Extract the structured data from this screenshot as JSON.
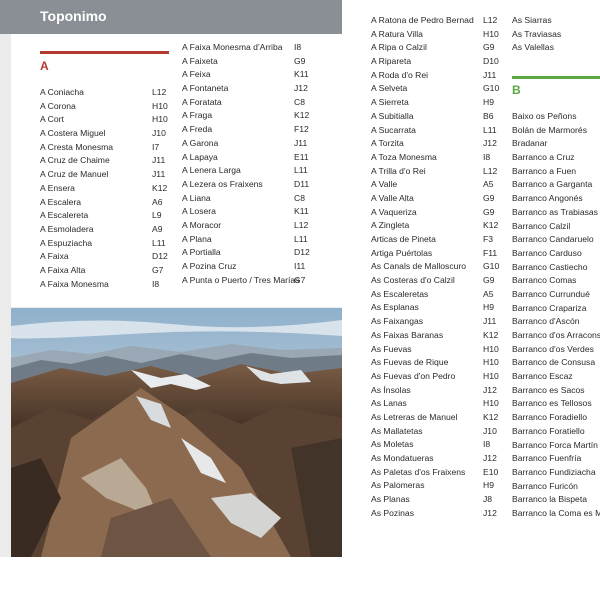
{
  "header": {
    "title": "Toponimo"
  },
  "section_a": {
    "letter": "A",
    "color": "#b23a2e",
    "entries": [
      {
        "name": "A Coniacha",
        "code": "L12"
      },
      {
        "name": "A Corona",
        "code": "H10"
      },
      {
        "name": "A Cort",
        "code": "H10"
      },
      {
        "name": "A Costera Miguel",
        "code": "J10"
      },
      {
        "name": "A Cresta Monesma",
        "code": "I7"
      },
      {
        "name": "A Cruz de Chaime",
        "code": "J11"
      },
      {
        "name": "A Cruz de Manuel",
        "code": "J11"
      },
      {
        "name": "A Ensera",
        "code": "K12"
      },
      {
        "name": "A Escalera",
        "code": "A6"
      },
      {
        "name": "A Escalereta",
        "code": "L9"
      },
      {
        "name": "A Esmoladera",
        "code": "A9"
      },
      {
        "name": "A Espuziacha",
        "code": "L11"
      },
      {
        "name": "A Faixa",
        "code": "D12"
      },
      {
        "name": "A Faixa Alta",
        "code": "G7"
      },
      {
        "name": "A Faixa Monesma",
        "code": "I8"
      }
    ]
  },
  "column_2": {
    "entries": [
      {
        "name": "A Faixa Monesma d'Arriba",
        "code": "I8"
      },
      {
        "name": "A Faixeta",
        "code": "G9"
      },
      {
        "name": "A Feixa",
        "code": "K11"
      },
      {
        "name": "A Fontaneta",
        "code": "J12"
      },
      {
        "name": "A Foratata",
        "code": "C8"
      },
      {
        "name": "A Fraga",
        "code": "K12"
      },
      {
        "name": "A Freda",
        "code": "F12"
      },
      {
        "name": "A Garona",
        "code": "J11"
      },
      {
        "name": "A Lapaya",
        "code": "E11"
      },
      {
        "name": "A Lenera Larga",
        "code": "L11"
      },
      {
        "name": "A Lezera os  Fraixens",
        "code": "D11"
      },
      {
        "name": "A Liana",
        "code": "C8"
      },
      {
        "name": "A Losera",
        "code": "K11"
      },
      {
        "name": "A Moracor",
        "code": "L12"
      },
      {
        "name": "A Plana",
        "code": "L11"
      },
      {
        "name": "A Portialla",
        "code": "D12"
      },
      {
        "name": "A Pozina Cruz",
        "code": "I11"
      },
      {
        "name": "A Punta o Puerto / Tres Marías",
        "code": "G7"
      }
    ]
  },
  "column_3": {
    "entries": [
      {
        "name": "A Ratona de Pedro Bernad",
        "code": "L12"
      },
      {
        "name": "A Ratura Villa",
        "code": "H10"
      },
      {
        "name": "A Ripa o Calzil",
        "code": "G9"
      },
      {
        "name": "A Ripareta",
        "code": "D10"
      },
      {
        "name": "A Roda d'o Rei",
        "code": "J11"
      },
      {
        "name": "A Selveta",
        "code": "G10"
      },
      {
        "name": "A Sierreta",
        "code": "H9"
      },
      {
        "name": "A Subitialla",
        "code": "B6"
      },
      {
        "name": "A Sucarrata",
        "code": "L11"
      },
      {
        "name": "A Torzita",
        "code": "J12"
      },
      {
        "name": "A Toza Monesma",
        "code": "I8"
      },
      {
        "name": "A Trilla d'o Rei",
        "code": "L12"
      },
      {
        "name": "A Valle",
        "code": "A5"
      },
      {
        "name": "A Valle Alta",
        "code": "G9"
      },
      {
        "name": "A Vaqueriza",
        "code": "G9"
      },
      {
        "name": "A Zingleta",
        "code": "K12"
      },
      {
        "name": "Articas de Pineta",
        "code": "F3"
      },
      {
        "name": "Artiga Puértolas",
        "code": "F11"
      },
      {
        "name": "As Canals de Malloscuro",
        "code": "G10"
      },
      {
        "name": "As Costeras d'o Calzil",
        "code": "G9"
      },
      {
        "name": "As Escaleretas",
        "code": "A5"
      },
      {
        "name": "As Esplanas",
        "code": "H9"
      },
      {
        "name": "As Faixangas",
        "code": "J11"
      },
      {
        "name": "As Faixas Baranas",
        "code": "K12"
      },
      {
        "name": "As Fuevas",
        "code": "H10"
      },
      {
        "name": "As Fuevas de Rique",
        "code": "H10"
      },
      {
        "name": "As Fuevas d'on Pedro",
        "code": "H10"
      },
      {
        "name": "As Ínsolas",
        "code": "J12"
      },
      {
        "name": "As Lanas",
        "code": "H10"
      },
      {
        "name": "As Letreras de Manuel",
        "code": "K12"
      },
      {
        "name": "As Mallatetas",
        "code": "J10"
      },
      {
        "name": "As Moletas",
        "code": "I8"
      },
      {
        "name": "As Mondatueras",
        "code": "J12"
      },
      {
        "name": "As Paletas d'os Fraixens",
        "code": "E10"
      },
      {
        "name": "As Palomeras",
        "code": "H9"
      },
      {
        "name": "As Planas",
        "code": "J8"
      },
      {
        "name": "As Pozinas",
        "code": "J12"
      }
    ]
  },
  "column_4_top": {
    "entries": [
      {
        "name": "As Siarras"
      },
      {
        "name": "As Traviasas"
      },
      {
        "name": "As Valellas"
      }
    ]
  },
  "section_b": {
    "letter": "B",
    "color": "#5aa546",
    "entries": [
      {
        "name": "Baixo os Peñons"
      },
      {
        "name": "Bolán de Marmorés"
      },
      {
        "name": "Bradanar"
      },
      {
        "name": "Barranco a Cruz"
      },
      {
        "name": "Barranco a Fuen"
      },
      {
        "name": "Barranco a Garganta"
      },
      {
        "name": "Barranco Angonés"
      },
      {
        "name": "Barranco as Trabiasas"
      },
      {
        "name": "Barranco Calzil"
      },
      {
        "name": "Barranco Candaruelo"
      },
      {
        "name": "Barranco Carduso"
      },
      {
        "name": "Barranco Castiecho"
      },
      {
        "name": "Barranco Comas"
      },
      {
        "name": "Barranco Currundué"
      },
      {
        "name": "Barranco Crapariza"
      },
      {
        "name": "Barranco d'Ascón"
      },
      {
        "name": "Barranco d'os Arracons"
      },
      {
        "name": "Barranco d'os Verdes"
      },
      {
        "name": "Barranco de Consusa"
      },
      {
        "name": "Barranco Escaz"
      },
      {
        "name": "Barranco es Sacos"
      },
      {
        "name": "Barranco es Tellosos"
      },
      {
        "name": "Barranco Foradiello"
      },
      {
        "name": "Barranco Foratiello"
      },
      {
        "name": "Barranco Forca Martín"
      },
      {
        "name": "Barranco Fuenfría"
      },
      {
        "name": "Barranco Fundiziacha"
      },
      {
        "name": "Barranco Furicón"
      },
      {
        "name": "Barranco la Bispeta"
      },
      {
        "name": "Barranco la Coma es Mo"
      }
    ]
  },
  "photo": {
    "subject": "mountain-landscape"
  },
  "colors": {
    "header": "#8a8f95",
    "panel": "#ebebeb"
  }
}
